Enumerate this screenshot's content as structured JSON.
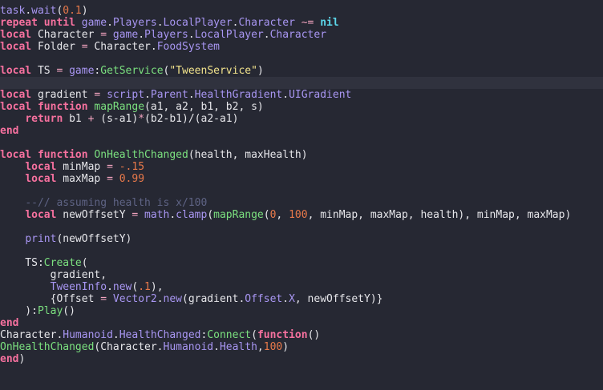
{
  "editor": {
    "current_line": 7,
    "lines": [
      [
        [
          "m",
          "task"
        ],
        [
          "p",
          "."
        ],
        [
          "m",
          "wait"
        ],
        [
          "p",
          "("
        ],
        [
          "n",
          "0.1"
        ],
        [
          "p",
          ")"
        ]
      ],
      [
        [
          "k",
          "repeat"
        ],
        [
          "i",
          " "
        ],
        [
          "k",
          "until"
        ],
        [
          "i",
          " "
        ],
        [
          "m",
          "game"
        ],
        [
          "p",
          "."
        ],
        [
          "m",
          "Players"
        ],
        [
          "p",
          "."
        ],
        [
          "m",
          "LocalPlayer"
        ],
        [
          "p",
          "."
        ],
        [
          "m",
          "Character"
        ],
        [
          "i",
          " "
        ],
        [
          "o",
          "~="
        ],
        [
          "i",
          " "
        ],
        [
          "nil",
          "nil"
        ]
      ],
      [
        [
          "k",
          "local"
        ],
        [
          "i",
          " Character "
        ],
        [
          "o",
          "="
        ],
        [
          "i",
          " "
        ],
        [
          "m",
          "game"
        ],
        [
          "p",
          "."
        ],
        [
          "m",
          "Players"
        ],
        [
          "p",
          "."
        ],
        [
          "m",
          "LocalPlayer"
        ],
        [
          "p",
          "."
        ],
        [
          "m",
          "Character"
        ]
      ],
      [
        [
          "k",
          "local"
        ],
        [
          "i",
          " Folder "
        ],
        [
          "o",
          "="
        ],
        [
          "i",
          " Character"
        ],
        [
          "p",
          "."
        ],
        [
          "m",
          "FoodSystem"
        ]
      ],
      [],
      [
        [
          "k",
          "local"
        ],
        [
          "i",
          " TS "
        ],
        [
          "o",
          "="
        ],
        [
          "i",
          " "
        ],
        [
          "m",
          "game"
        ],
        [
          "p",
          ":"
        ],
        [
          "f",
          "GetService"
        ],
        [
          "p",
          "("
        ],
        [
          "s",
          "\"TweenService\""
        ],
        [
          "p",
          ")"
        ]
      ],
      [],
      [
        [
          "k",
          "local"
        ],
        [
          "i",
          " gradient "
        ],
        [
          "o",
          "="
        ],
        [
          "i",
          " "
        ],
        [
          "m",
          "script"
        ],
        [
          "p",
          "."
        ],
        [
          "m",
          "Parent"
        ],
        [
          "p",
          "."
        ],
        [
          "m",
          "HealthGradient"
        ],
        [
          "p",
          "."
        ],
        [
          "m",
          "UIGradient"
        ]
      ],
      [
        [
          "k",
          "local"
        ],
        [
          "i",
          " "
        ],
        [
          "k",
          "function"
        ],
        [
          "i",
          " "
        ],
        [
          "f",
          "mapRange"
        ],
        [
          "i",
          "(a1, a2, b1, b2, s)"
        ]
      ],
      [
        [
          "i",
          "    "
        ],
        [
          "k",
          "return"
        ],
        [
          "i",
          " b1 "
        ],
        [
          "o",
          "+"
        ],
        [
          "i",
          " (s-a1)"
        ],
        [
          "o",
          "*"
        ],
        [
          "i",
          "(b2-b1)/(a2-a1)"
        ]
      ],
      [
        [
          "k",
          "end"
        ]
      ],
      [],
      [
        [
          "k",
          "local"
        ],
        [
          "i",
          " "
        ],
        [
          "k",
          "function"
        ],
        [
          "i",
          " "
        ],
        [
          "f",
          "OnHealthChanged"
        ],
        [
          "i",
          "(health, maxHealth)"
        ]
      ],
      [
        [
          "i",
          "    "
        ],
        [
          "k",
          "local"
        ],
        [
          "i",
          " minMap "
        ],
        [
          "o",
          "="
        ],
        [
          "i",
          " "
        ],
        [
          "n",
          "-.15"
        ]
      ],
      [
        [
          "i",
          "    "
        ],
        [
          "k",
          "local"
        ],
        [
          "i",
          " maxMap "
        ],
        [
          "o",
          "="
        ],
        [
          "i",
          " "
        ],
        [
          "n",
          "0.99"
        ]
      ],
      [],
      [
        [
          "i",
          "    "
        ],
        [
          "c",
          "--// assuming health is x/100"
        ]
      ],
      [
        [
          "i",
          "    "
        ],
        [
          "k",
          "local"
        ],
        [
          "i",
          " newOffsetY "
        ],
        [
          "o",
          "="
        ],
        [
          "i",
          " "
        ],
        [
          "m",
          "math"
        ],
        [
          "p",
          "."
        ],
        [
          "m",
          "clamp"
        ],
        [
          "p",
          "("
        ],
        [
          "f",
          "mapRange"
        ],
        [
          "p",
          "("
        ],
        [
          "n",
          "0"
        ],
        [
          "i",
          ", "
        ],
        [
          "n",
          "100"
        ],
        [
          "i",
          ", minMap, maxMap, health), minMap, maxMap)"
        ]
      ],
      [],
      [
        [
          "i",
          "    "
        ],
        [
          "m",
          "print"
        ],
        [
          "i",
          "(newOffsetY)"
        ]
      ],
      [],
      [
        [
          "i",
          "    TS:"
        ],
        [
          "f",
          "Create"
        ],
        [
          "i",
          "("
        ]
      ],
      [
        [
          "i",
          "        gradient,"
        ]
      ],
      [
        [
          "i",
          "        "
        ],
        [
          "m",
          "TweenInfo"
        ],
        [
          "p",
          "."
        ],
        [
          "m",
          "new"
        ],
        [
          "i",
          "("
        ],
        [
          "n",
          ".1"
        ],
        [
          "i",
          "),"
        ]
      ],
      [
        [
          "i",
          "        {Offset "
        ],
        [
          "o",
          "="
        ],
        [
          "i",
          " "
        ],
        [
          "m",
          "Vector2"
        ],
        [
          "p",
          "."
        ],
        [
          "m",
          "new"
        ],
        [
          "i",
          "(gradient."
        ],
        [
          "m",
          "Offset"
        ],
        [
          "i",
          "."
        ],
        [
          "m",
          "X"
        ],
        [
          "i",
          ", newOffsetY)}"
        ]
      ],
      [
        [
          "i",
          "    ):"
        ],
        [
          "f",
          "Play"
        ],
        [
          "i",
          "()"
        ]
      ],
      [
        [
          "k",
          "end"
        ]
      ],
      [
        [
          "i",
          "Character."
        ],
        [
          "m",
          "Humanoid"
        ],
        [
          "p",
          "."
        ],
        [
          "m",
          "HealthChanged"
        ],
        [
          "i",
          ":"
        ],
        [
          "f",
          "Connect"
        ],
        [
          "i",
          "("
        ],
        [
          "k",
          "function"
        ],
        [
          "i",
          "()"
        ]
      ],
      [
        [
          "f",
          "OnHealthChanged"
        ],
        [
          "i",
          "(Character."
        ],
        [
          "m",
          "Humanoid"
        ],
        [
          "p",
          "."
        ],
        [
          "m",
          "Health"
        ],
        [
          "i",
          ","
        ],
        [
          "n",
          "100"
        ],
        [
          "i",
          ")"
        ]
      ],
      [
        [
          "k",
          "end"
        ],
        [
          "i",
          ")"
        ]
      ]
    ]
  }
}
